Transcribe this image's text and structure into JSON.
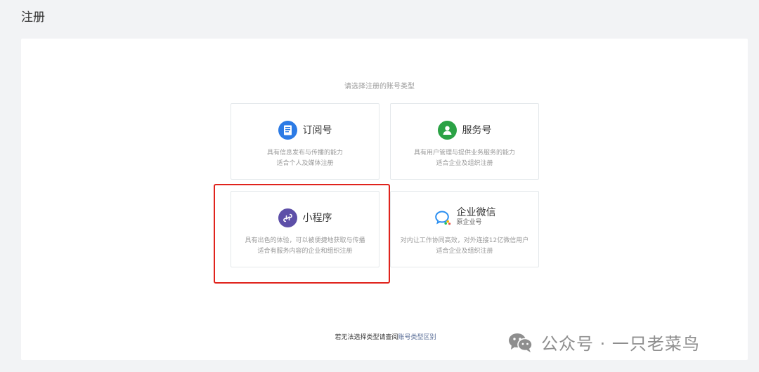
{
  "header": {
    "title": "注册"
  },
  "prompt": "请选择注册的账号类型",
  "cards": [
    {
      "name": "订阅号",
      "desc_line1": "具有信息发布与传播的能力",
      "desc_line2": "适合个人及媒体注册",
      "icon": "document-icon",
      "icon_color": "#2c7be5"
    },
    {
      "name": "服务号",
      "desc_line1": "具有用户管理与提供业务服务的能力",
      "desc_line2": "适合企业及组织注册",
      "icon": "user-service-icon",
      "icon_color": "#2ba245"
    },
    {
      "name": "小程序",
      "desc_line1": "具有出色的体验，可以被便捷地获取与传播",
      "desc_line2": "适合有服务内容的企业和组织注册",
      "icon": "mini-program-icon",
      "icon_color": "#5d4fa8"
    },
    {
      "name": "企业微信",
      "subname": "原企业号",
      "desc_line1": "对内让工作协同高效，对外连接12亿微信用户",
      "desc_line2": "适合企业及组织注册",
      "icon": "work-wechat-icon",
      "icon_color": "#2a8ef0"
    }
  ],
  "footer": {
    "hint": "若无法选择类型请查阅",
    "link": "账号类型区别"
  },
  "watermark": {
    "text": "公众号 · 一只老菜鸟",
    "icon": "wechat-logo-icon"
  },
  "colors": {
    "highlight": "#e0231c",
    "link": "#576b95"
  }
}
